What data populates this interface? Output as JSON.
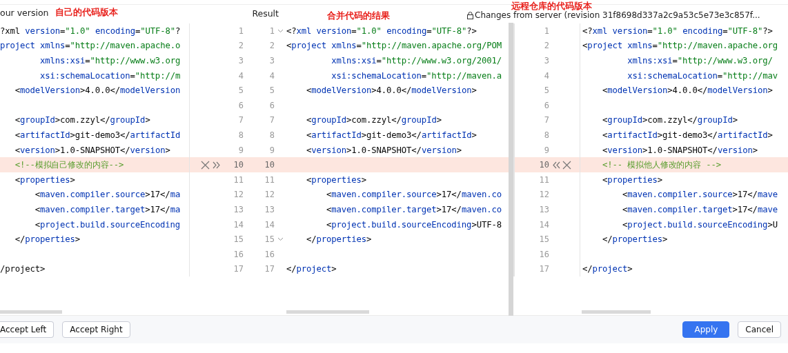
{
  "header": {
    "left_label": "our version",
    "left_note": "自己的代码版本",
    "result_label": "Result",
    "result_note": "合并代码的结果",
    "server_note": "远程仓库的代码版本",
    "server_label": "Changes from server (revision 31f8698d337a2c9a53c5e73e3c857f..."
  },
  "lines": [
    {
      "left": "?xml version=\"1.0\" encoding=\"UTF-8\"?",
      "left_no": "1",
      "result_no": "1",
      "result": "<?xml version=\"1.0\" encoding=\"UTF-8\"?>",
      "right_no": "1",
      "right": "<?xml version=\"1.0\" encoding=\"UTF-8\"?>",
      "conflict": false,
      "fold": true
    },
    {
      "left": "project xmlns=\"http://maven.apache.o",
      "left_no": "2",
      "result_no": "2",
      "result": "<project xmlns=\"http://maven.apache.org/POM",
      "right_no": "2",
      "right": "<project xmlns=\"http://maven.apache.org",
      "conflict": false,
      "fold": false
    },
    {
      "left": "        xmlns:xsi=\"http://www.w3.org",
      "left_no": "3",
      "result_no": "3",
      "result": "         xmlns:xsi=\"http://www.w3.org/2001/",
      "right_no": "3",
      "right": "         xmlns:xsi=\"http://www.w3.org/",
      "conflict": false,
      "fold": false
    },
    {
      "left": "        xsi:schemaLocation=\"http://m",
      "left_no": "4",
      "result_no": "4",
      "result": "         xsi:schemaLocation=\"http://maven.a",
      "right_no": "4",
      "right": "         xsi:schemaLocation=\"http://mav",
      "conflict": false,
      "fold": false
    },
    {
      "left": "   <modelVersion>4.0.0</modelVersion",
      "left_no": "5",
      "result_no": "5",
      "result": "    <modelVersion>4.0.0</modelVersion>",
      "right_no": "5",
      "right": "    <modelVersion>4.0.0</modelVersion>",
      "conflict": false,
      "fold": false
    },
    {
      "left_no": "6",
      "result_no": "6",
      "right_no": "6",
      "conflict": false,
      "fold": false
    },
    {
      "left": "   <groupId>com.zzyl</groupId>",
      "left_no": "7",
      "result_no": "7",
      "result": "    <groupId>com.zzyl</groupId>",
      "right_no": "7",
      "right": "    <groupId>com.zzyl</groupId>",
      "conflict": false,
      "fold": false
    },
    {
      "left": "   <artifactId>git-demo3</artifactId",
      "left_no": "8",
      "result_no": "8",
      "result": "    <artifactId>git-demo3</artifactId>",
      "right_no": "8",
      "right": "    <artifactId>git-demo3</artifactId>",
      "conflict": false,
      "fold": false
    },
    {
      "left": "   <version>1.0-SNAPSHOT</version>",
      "left_no": "9",
      "result_no": "9",
      "result": "    <version>1.0-SNAPSHOT</version>",
      "right_no": "9",
      "right": "    <version>1.0-SNAPSHOT</version>",
      "conflict": false,
      "fold": false
    },
    {
      "left": "   <!--模拟自己修改的内容-->",
      "left_no": "10",
      "result_no": "10",
      "right_no": "10",
      "right": "    <!-- 模拟他人修改的内容 -->",
      "conflict": true,
      "fold": false
    },
    {
      "left": "   <properties>",
      "left_no": "11",
      "result_no": "11",
      "result": "    <properties>",
      "right_no": "11",
      "right": "    <properties>",
      "conflict": false,
      "fold": false
    },
    {
      "left": "       <maven.compiler.source>17</ma",
      "left_no": "12",
      "result_no": "12",
      "result": "        <maven.compiler.source>17</maven.co",
      "right_no": "12",
      "right": "        <maven.compiler.source>17</mave",
      "conflict": false,
      "fold": false
    },
    {
      "left": "       <maven.compiler.target>17</ma",
      "left_no": "13",
      "result_no": "13",
      "result": "        <maven.compiler.target>17</maven.co",
      "right_no": "13",
      "right": "        <maven.compiler.target>17</mave",
      "conflict": false,
      "fold": false
    },
    {
      "left": "       <project.build.sourceEncoding",
      "left_no": "14",
      "result_no": "14",
      "result": "        <project.build.sourceEncoding>UTF-8",
      "right_no": "14",
      "right": "        <project.build.sourceEncoding>U",
      "conflict": false,
      "fold": false
    },
    {
      "left": "   </properties>",
      "left_no": "15",
      "result_no": "15",
      "result": "    </properties>",
      "right_no": "15",
      "right": "    </properties>",
      "conflict": false,
      "fold": true
    },
    {
      "left_no": "16",
      "result_no": "16",
      "right_no": "16",
      "conflict": false,
      "fold": false
    },
    {
      "left": "/project>",
      "left_no": "17",
      "result_no": "17",
      "result": "</project>",
      "right_no": "17",
      "right": "</project>",
      "conflict": false,
      "fold": false
    }
  ],
  "buttons": [
    {
      "label": "Accept Left",
      "kind": "plain"
    },
    {
      "label": "Accept Right",
      "kind": "plain"
    },
    {
      "label": "Apply",
      "kind": "primary"
    },
    {
      "label": "Cancel",
      "kind": "plain"
    }
  ]
}
